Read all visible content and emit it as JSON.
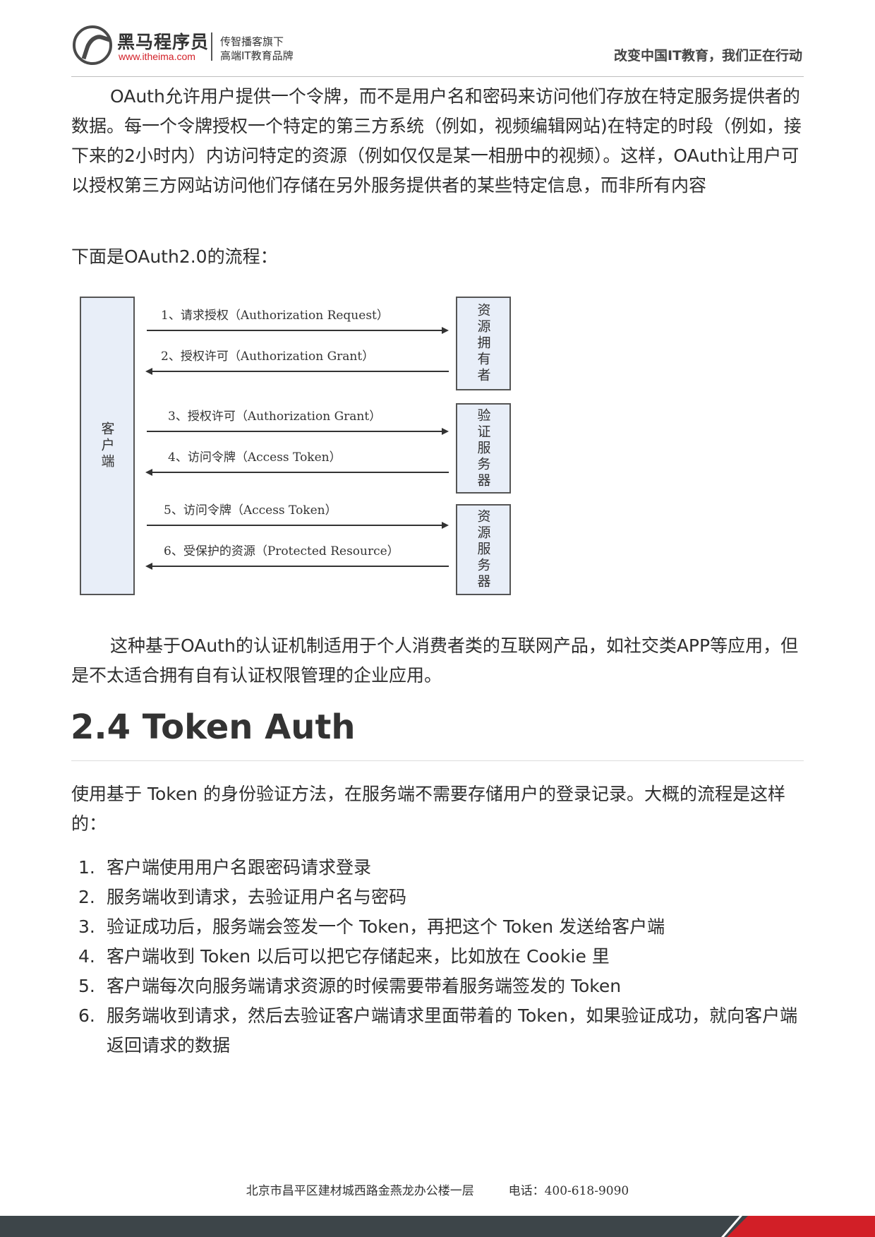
{
  "header": {
    "brand_name": "黑马程序员",
    "brand_url": "www.itheima.com",
    "tagline_1": "传智播客旗下",
    "tagline_2": "高端IT教育品牌",
    "slogan": "改变中国IT教育，我们正在行动"
  },
  "intro": {
    "paragraph": "OAuth允许用户提供一个令牌，而不是用户名和密码来访问他们存放在特定服务提供者的数据。每一个令牌授权一个特定的第三方系统（例如，视频编辑网站)在特定的时段（例如，接下来的2小时内）内访问特定的资源（例如仅仅是某一相册中的视频）。这样，OAuth让用户可以授权第三方网站访问他们存储在另外服务提供者的某些特定信息，而非所有内容",
    "flow_lead": "下面是OAuth2.0的流程："
  },
  "diagram": {
    "client": "客户端",
    "resource_owner": "资源拥有者",
    "auth_server": "验证服务器",
    "resource_server": "资源服务器",
    "steps": [
      "1、请求授权（Authorization Request）",
      "2、授权许可（Authorization Grant）",
      "3、授权许可（Authorization Grant）",
      "4、访问令牌（Access Token）",
      "5、访问令牌（Access Token）",
      "6、受保护的资源（Protected Resource）"
    ]
  },
  "after_diagram": "这种基于OAuth的认证机制适用于个人消费者类的互联网产品，如社交类APP等应用，但是不太适合拥有自有认证权限管理的企业应用。",
  "section": {
    "heading": "2.4 Token Auth",
    "intro": "使用基于 Token 的身份验证方法，在服务端不需要存储用户的登录记录。大概的流程是这样的：",
    "items": [
      {
        "num": "1.",
        "text": "客户端使用用户名跟密码请求登录"
      },
      {
        "num": "2.",
        "text": "服务端收到请求，去验证用户名与密码"
      },
      {
        "num": "3.",
        "text": "验证成功后，服务端会签发一个 Token，再把这个 Token 发送给客户端"
      },
      {
        "num": "4.",
        "text": "客户端收到 Token 以后可以把它存储起来，比如放在 Cookie 里"
      },
      {
        "num": "5.",
        "text": "客户端每次向服务端请求资源的时候需要带着服务端签发的 Token"
      },
      {
        "num": "6.",
        "text": "服务端收到请求，然后去验证客户端请求里面带着的 Token，如果验证成功，就向客户端返回请求的数据"
      }
    ]
  },
  "footer": {
    "address": "北京市昌平区建材城西路金燕龙办公楼一层",
    "phone": "电话：400-618-9090"
  }
}
